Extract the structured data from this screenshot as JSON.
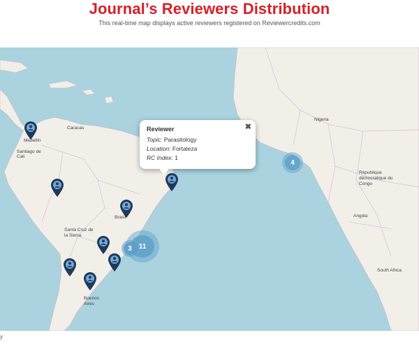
{
  "header": {
    "title": "Journal’s Reviewers Distribution",
    "subtitle": "This real-time map displays active reviewers registered on Reviewercredits.com"
  },
  "popup": {
    "title": "Reviewer",
    "close_glyph": "✖",
    "fields": [
      {
        "label": "Topic:",
        "value": "Parasitology"
      },
      {
        "label": "Location:",
        "value": "Fortaleza"
      },
      {
        "label": "RC Index:",
        "value": "1"
      }
    ]
  },
  "clusters": [
    {
      "name": "cluster-atlantic",
      "count": "4"
    },
    {
      "name": "cluster-southeast-brazil-large",
      "count": "11"
    },
    {
      "name": "cluster-southeast-brazil-small",
      "count": "3"
    }
  ],
  "markers": [
    {
      "name": "marker-medellin",
      "label": "Reviewer"
    },
    {
      "name": "marker-fortaleza",
      "label": "Reviewer"
    },
    {
      "name": "marker-peru-north",
      "label": "Reviewer"
    },
    {
      "name": "marker-brasilia",
      "label": "Reviewer"
    },
    {
      "name": "marker-paraguay",
      "label": "Reviewer"
    },
    {
      "name": "marker-argentina-north",
      "label": "Reviewer"
    },
    {
      "name": "marker-porto-alegre",
      "label": "Reviewer"
    },
    {
      "name": "marker-buenos-aires",
      "label": "Reviewer"
    }
  ],
  "map_labels": {
    "caracas": "Caracas",
    "medellin": "Medellín",
    "santiago_de_cali": "Santiago de Cali",
    "brasil": "Brasil",
    "santa_cruz": "Santa Cruz de la Sierra",
    "buenos_aires": "Buenos Aires",
    "south_africa": "South Africa",
    "rdc": "République démocratique du Congo",
    "angola": "Angola",
    "nigeria": "Nigeria"
  },
  "colors": {
    "water": "#aad3df",
    "land": "#f2efe9",
    "marker": "#1f3a58",
    "marker_inner": "#6fa8dc",
    "cluster": "#5c9fc9",
    "title": "#d72027"
  },
  "footer": {
    "mark": "y"
  }
}
